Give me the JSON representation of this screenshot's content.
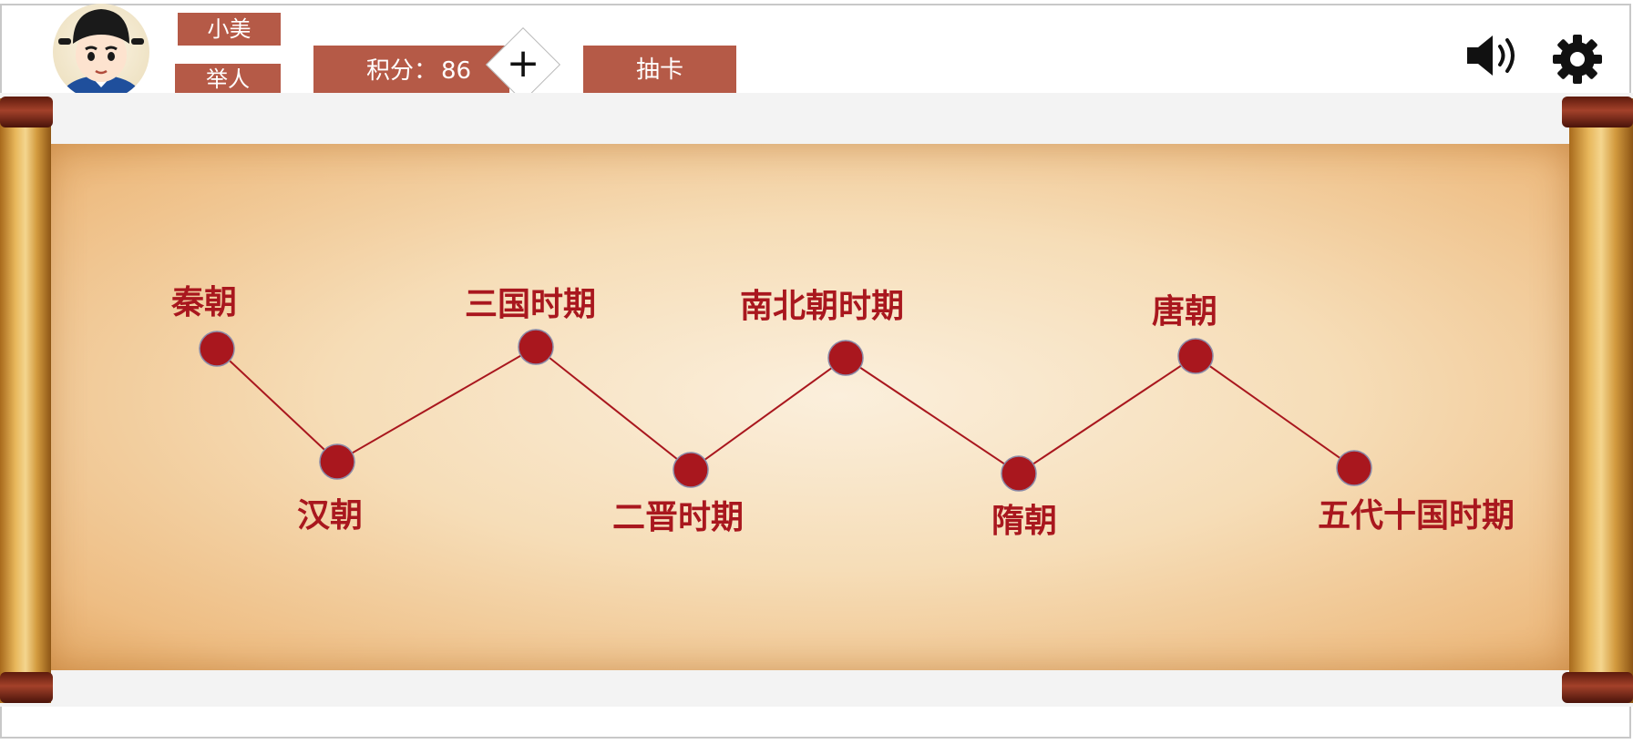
{
  "player": {
    "name": "小美",
    "rank": "举人",
    "score_label": "积分：",
    "score_value": "86"
  },
  "toolbar": {
    "add_score_symbol": "+",
    "draw_card_label": "抽卡",
    "sound_icon": "speaker-icon",
    "settings_icon": "gear-icon"
  },
  "timeline": {
    "eras": [
      {
        "label": "秦朝"
      },
      {
        "label": "汉朝"
      },
      {
        "label": "三国时期"
      },
      {
        "label": "二晋时期"
      },
      {
        "label": "南北朝时期"
      },
      {
        "label": "隋朝"
      },
      {
        "label": "唐朝"
      },
      {
        "label": "五代十国时期"
      }
    ]
  },
  "colors": {
    "accent": "#b55a47",
    "node": "#a9171e",
    "line": "#a9171e"
  }
}
